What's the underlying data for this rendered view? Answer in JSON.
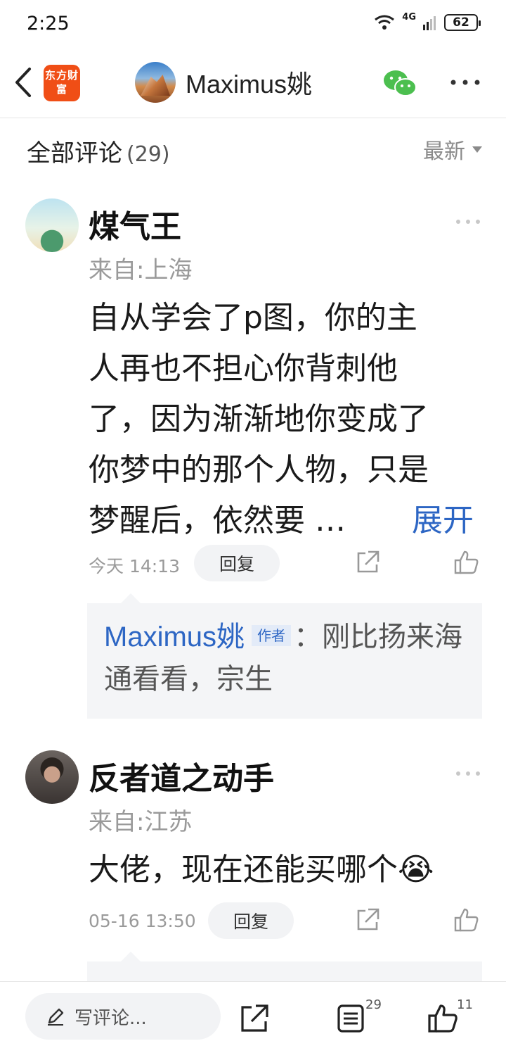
{
  "status_bar": {
    "time": "2:25",
    "network": "4G",
    "battery": "62"
  },
  "nav": {
    "app_logo": "东方财富",
    "author_name": "Maximus姚"
  },
  "comments_header": {
    "title": "全部评论",
    "count": "(29)",
    "sort_label": "最新"
  },
  "comments": [
    {
      "username": "煤气王",
      "location": "来自:上海",
      "text_lines": [
        "自从学会了p图，你的主",
        "人再也不担心你背刺他",
        "了，因为渐渐地你变成了",
        "你梦中的那个人物，只是",
        "梦醒后，依然要 …"
      ],
      "expand_label": "展开",
      "time": "今天 14:13",
      "reply_label": "回复",
      "reply": {
        "author": "Maximus姚",
        "badge": "作者",
        "text": "：刚比扬来海通看看，宗生"
      }
    },
    {
      "username": "反者道之动手",
      "location": "来自:江苏",
      "text": "大佬，现在还能买哪个😭",
      "time": "05-16 13:50",
      "reply_label": "回复"
    }
  ],
  "bottom_bar": {
    "write_placeholder": "写评论...",
    "comments_count": "29",
    "likes_count": "11"
  }
}
